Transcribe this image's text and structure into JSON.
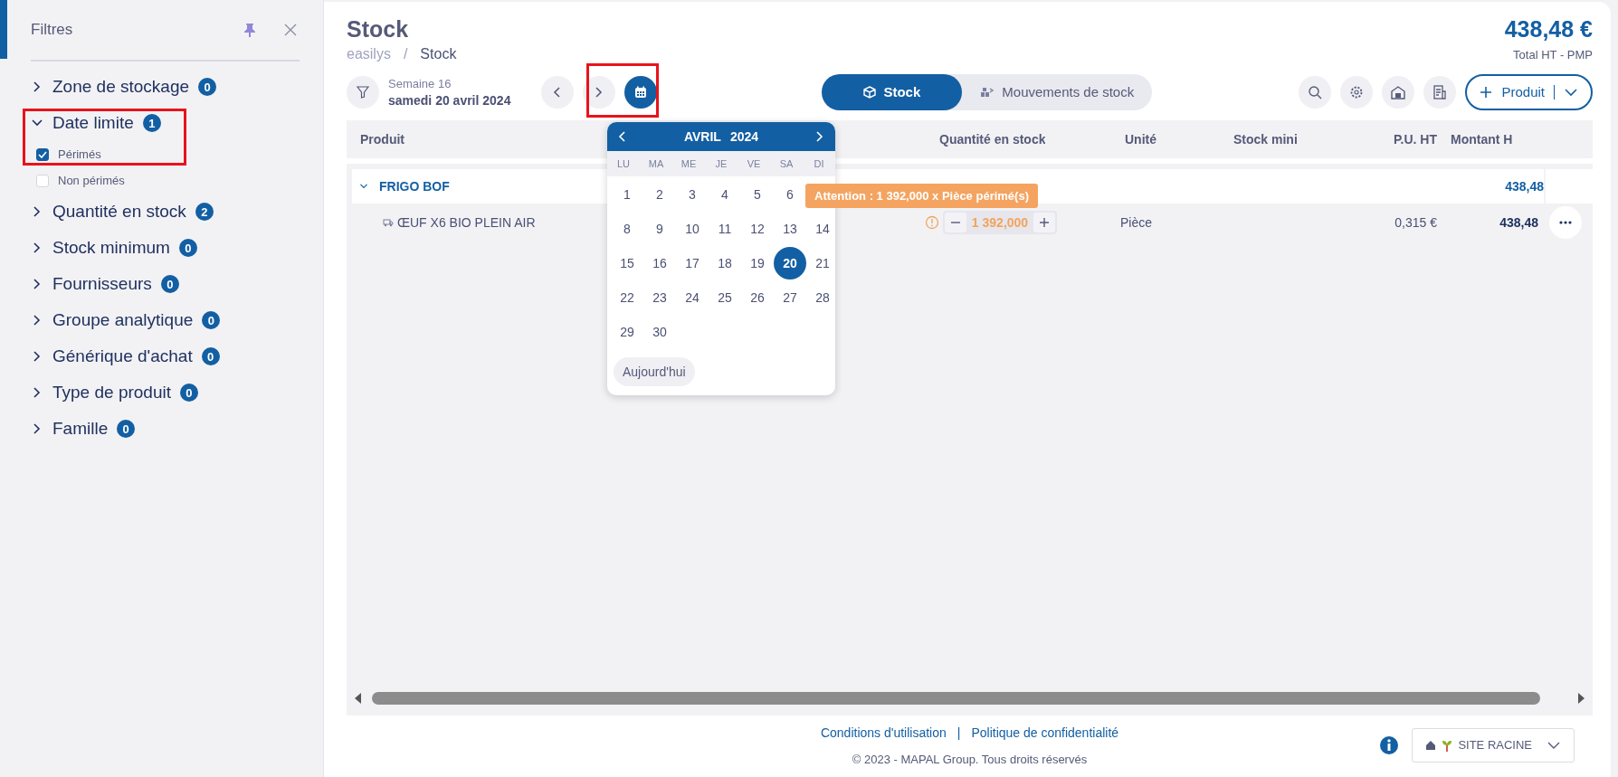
{
  "sidebar": {
    "title": "Filtres",
    "filters": [
      {
        "label": "Zone de stockage",
        "count": "0",
        "expanded": false
      },
      {
        "label": "Date limite",
        "count": "1",
        "expanded": true,
        "options": [
          {
            "label": "Périmés",
            "checked": true
          },
          {
            "label": "Non périmés",
            "checked": false
          }
        ]
      },
      {
        "label": "Quantité en stock",
        "count": "2",
        "expanded": false
      },
      {
        "label": "Stock minimum",
        "count": "0",
        "expanded": false
      },
      {
        "label": "Fournisseurs",
        "count": "0",
        "expanded": false
      },
      {
        "label": "Groupe analytique",
        "count": "0",
        "expanded": false
      },
      {
        "label": "Générique d'achat",
        "count": "0",
        "expanded": false
      },
      {
        "label": "Type de produit",
        "count": "0",
        "expanded": false
      },
      {
        "label": "Famille",
        "count": "0",
        "expanded": false
      }
    ]
  },
  "header": {
    "title": "Stock",
    "breadcrumb": [
      "easilys",
      "Stock"
    ],
    "separator": "/",
    "total": "438,48 €",
    "total_label": "Total HT - PMP"
  },
  "toolbar": {
    "week": "Semaine 16",
    "date": "samedi 20 avril 2024",
    "view_tabs": [
      {
        "label": "Stock",
        "selected": true
      },
      {
        "label": "Mouvements de stock",
        "selected": false
      }
    ],
    "add_button": "Produit"
  },
  "table": {
    "columns": [
      "Produit",
      "Quantité en stock",
      "Unité",
      "Stock mini",
      "P.U. HT",
      "Montant H"
    ],
    "groups": [
      {
        "name": "FRIGO BOF",
        "expanded": true,
        "amount": "438,48",
        "rows": [
          {
            "product": "ŒUF X6 BIO PLEIN AIR",
            "quantity": "1 392,000",
            "unit": "Pièce",
            "unit_price": "0,315 €",
            "amount": "438,48",
            "warning": "Attention : 1 392,000 x Pièce périmé(s)"
          }
        ]
      }
    ]
  },
  "calendar": {
    "month": "AVRIL",
    "year": "2024",
    "weekdays": [
      "LU",
      "MA",
      "ME",
      "JE",
      "VE",
      "SA",
      "DI"
    ],
    "weeks": [
      [
        {
          "label": "1",
          "selected": false
        },
        {
          "label": "2",
          "selected": false
        },
        {
          "label": "3",
          "selected": false
        },
        {
          "label": "4",
          "selected": false
        },
        {
          "label": "5",
          "selected": false
        },
        {
          "label": "6",
          "selected": false
        }
      ],
      [
        {
          "label": "8",
          "selected": false
        },
        {
          "label": "9",
          "selected": false
        },
        {
          "label": "10",
          "selected": false
        },
        {
          "label": "11",
          "selected": false
        },
        {
          "label": "12",
          "selected": false
        },
        {
          "label": "13",
          "selected": false
        },
        {
          "label": "14",
          "selected": false
        }
      ],
      [
        {
          "label": "15",
          "selected": false
        },
        {
          "label": "16",
          "selected": false
        },
        {
          "label": "17",
          "selected": false
        },
        {
          "label": "18",
          "selected": false
        },
        {
          "label": "19",
          "selected": false
        },
        {
          "label": "20",
          "selected": true
        },
        {
          "label": "21",
          "selected": false
        }
      ],
      [
        {
          "label": "22",
          "selected": false
        },
        {
          "label": "23",
          "selected": false
        },
        {
          "label": "24",
          "selected": false
        },
        {
          "label": "25",
          "selected": false
        },
        {
          "label": "26",
          "selected": false
        },
        {
          "label": "27",
          "selected": false
        },
        {
          "label": "28",
          "selected": false
        }
      ],
      [
        {
          "label": "29",
          "selected": false
        },
        {
          "label": "30",
          "selected": false
        }
      ]
    ],
    "today_button": "Aujourd'hui"
  },
  "footer": {
    "links": [
      "Conditions d'utilisation",
      "Politique de confidentialité"
    ],
    "separator": "|",
    "copyright": "© 2023 - MAPAL Group. Tous droits réservés",
    "site": "SITE RACINE"
  }
}
